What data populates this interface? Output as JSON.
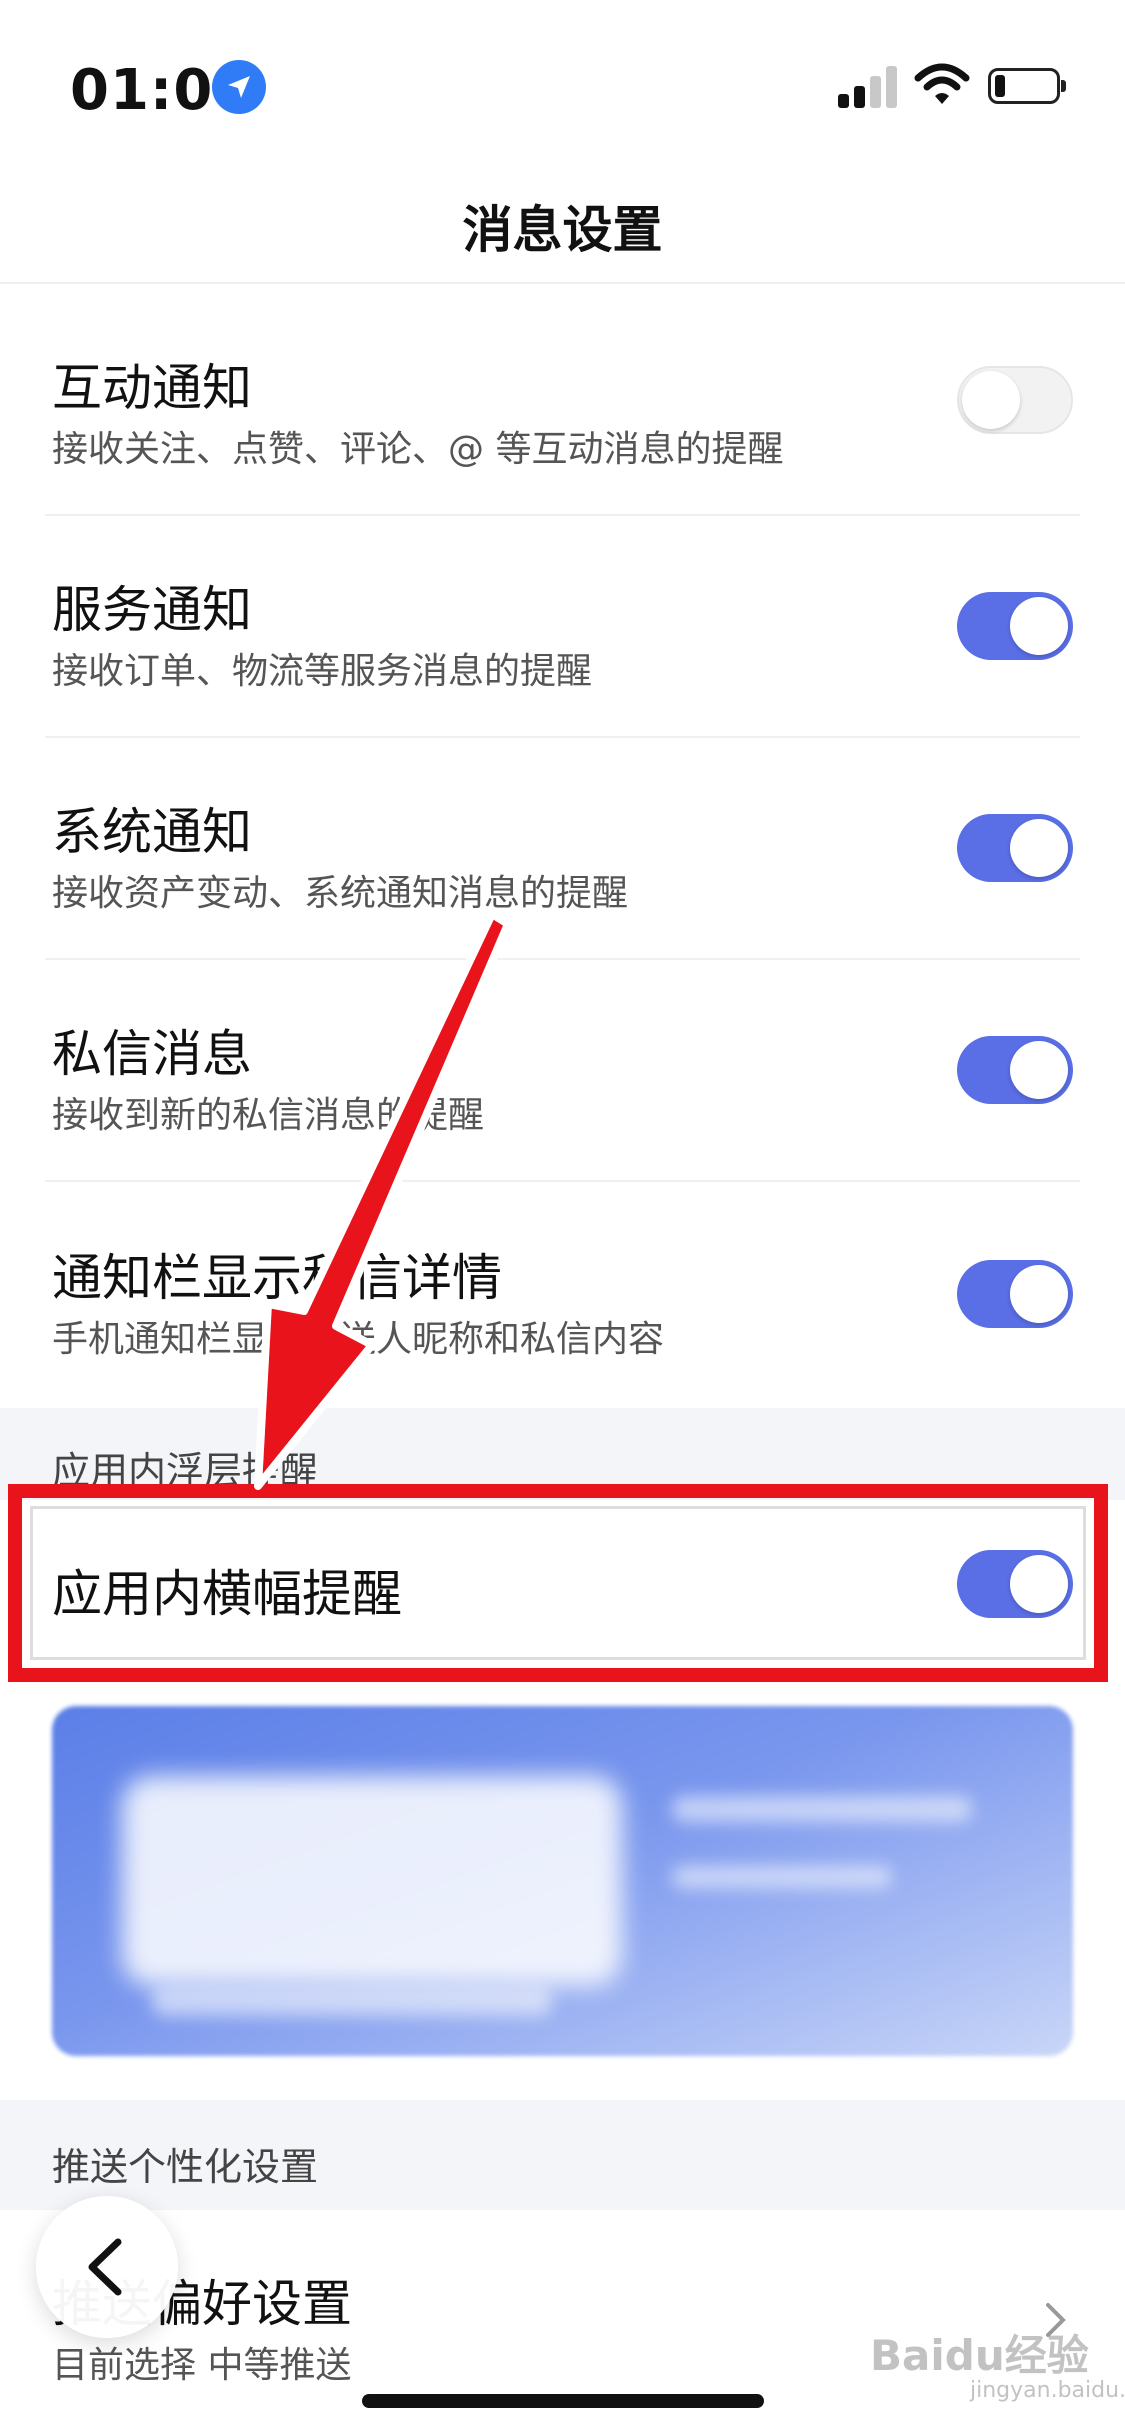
{
  "status": {
    "time": "01:00"
  },
  "nav": {
    "title": "消息设置"
  },
  "settings": [
    {
      "title": "互动通知",
      "subtitle": "接收关注、点赞、评论、@ 等互动消息的提醒",
      "on": false
    },
    {
      "title": "服务通知",
      "subtitle": "接收订单、物流等服务消息的提醒",
      "on": true
    },
    {
      "title": "系统通知",
      "subtitle": "接收资产变动、系统通知消息的提醒",
      "on": true
    },
    {
      "title": "私信消息",
      "subtitle": "接收到新的私信消息的提醒",
      "on": true
    },
    {
      "title": "通知栏显示私信详情",
      "subtitle": "手机通知栏显示发送人昵称和私信内容",
      "on": true
    }
  ],
  "section_inapp": {
    "label": "应用内浮层提醒"
  },
  "banner_setting": {
    "title": "应用内横幅提醒",
    "on": true
  },
  "section_push": {
    "label": "推送个性化设置"
  },
  "push_pref": {
    "title": "推送偏好设置",
    "subtitle": "目前选择 中等推送"
  },
  "watermark": {
    "text": "Baidu经验",
    "sub": "jingyan.baidu.com"
  },
  "colors": {
    "accent": "#5a6ee6",
    "annotation": "#e8131b"
  }
}
